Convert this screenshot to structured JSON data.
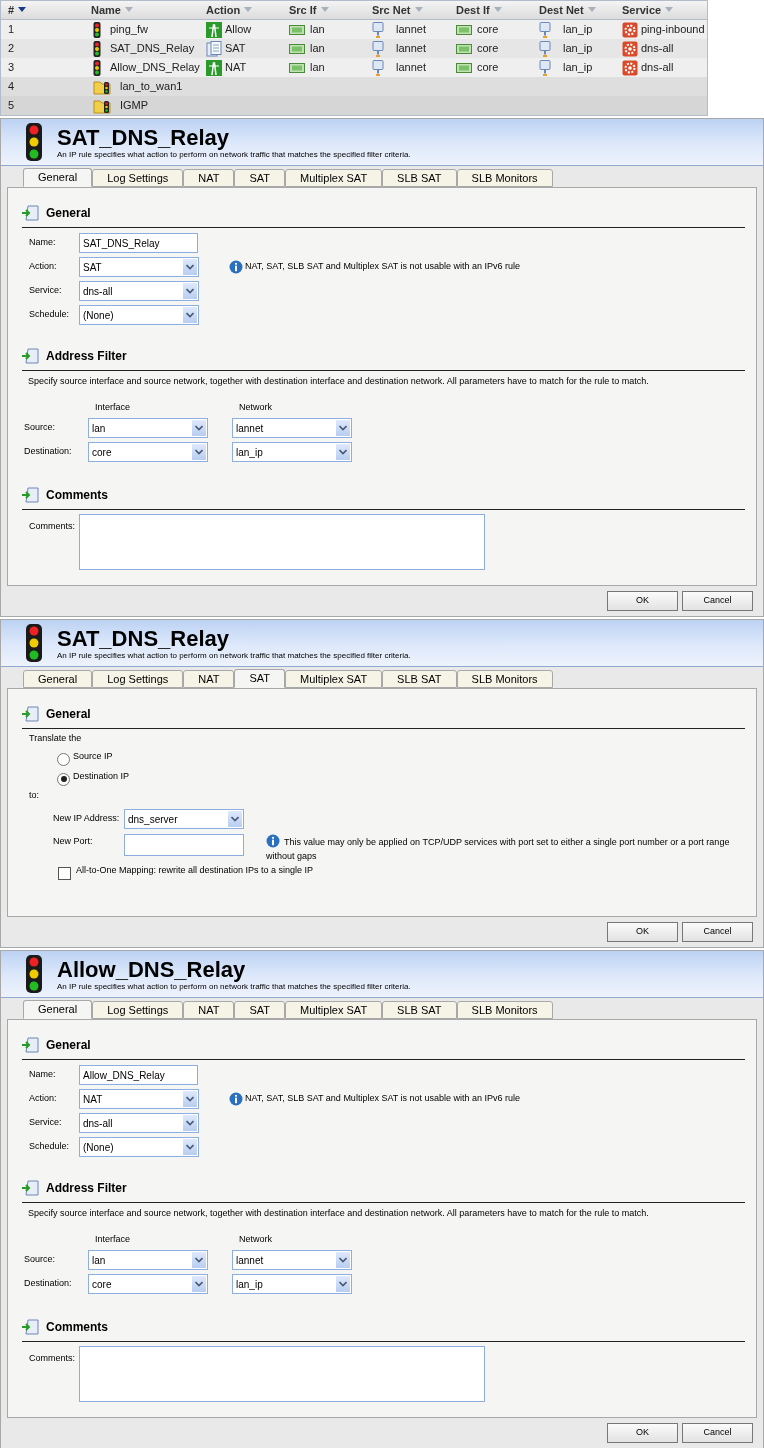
{
  "rules_table": {
    "columns": [
      {
        "label": "#",
        "sorted": true
      },
      {
        "label": "Name",
        "sorted": false
      },
      {
        "label": "Action",
        "sorted": false
      },
      {
        "label": "Src If",
        "sorted": false
      },
      {
        "label": "Src Net",
        "sorted": false
      },
      {
        "label": "Dest If",
        "sorted": false
      },
      {
        "label": "Dest Net",
        "sorted": false
      },
      {
        "label": "Service",
        "sorted": false
      }
    ],
    "rows": [
      {
        "number": "1",
        "kind": "rule",
        "name": "ping_fw",
        "action": {
          "label": "Allow",
          "kind": "allow"
        },
        "src_if": "lan",
        "src_net": "lannet",
        "dest_if": "core",
        "dest_net": "lan_ip",
        "service": "ping-inbound"
      },
      {
        "number": "2",
        "kind": "rule",
        "name": "SAT_DNS_Relay",
        "action": {
          "label": "SAT",
          "kind": "sat"
        },
        "src_if": "lan",
        "src_net": "lannet",
        "dest_if": "core",
        "dest_net": "lan_ip",
        "service": "dns-all"
      },
      {
        "number": "3",
        "kind": "rule",
        "name": "Allow_DNS_Relay",
        "action": {
          "label": "NAT",
          "kind": "nat"
        },
        "src_if": "lan",
        "src_net": "lannet",
        "dest_if": "core",
        "dest_net": "lan_ip",
        "service": "dns-all"
      },
      {
        "number": "4",
        "kind": "folder",
        "name": "lan_to_wan1"
      },
      {
        "number": "5",
        "kind": "folder",
        "name": "IGMP"
      }
    ]
  },
  "panels": [
    {
      "kind": "general",
      "title": "SAT_DNS_Relay",
      "description": "An IP rule specifies what action to perform on network traffic that matches the specified filter criteria.",
      "tabs": [
        {
          "label": "General",
          "selected": true
        },
        {
          "label": "Log Settings",
          "selected": false
        },
        {
          "label": "NAT",
          "selected": false
        },
        {
          "label": "SAT",
          "selected": false
        },
        {
          "label": "Multiplex SAT",
          "selected": false
        },
        {
          "label": "SLB SAT",
          "selected": false
        },
        {
          "label": "SLB Monitors",
          "selected": false
        }
      ],
      "general": {
        "heading": "General",
        "fields": [
          {
            "label": "Name:",
            "kind": "text",
            "value": "SAT_DNS_Relay"
          },
          {
            "label": "Action:",
            "kind": "select",
            "value": "SAT",
            "note": "NAT, SAT, SLB SAT and Multiplex SAT is not usable with an IPv6 rule"
          },
          {
            "label": "Service:",
            "kind": "select",
            "value": "dns-all"
          },
          {
            "label": "Schedule:",
            "kind": "select",
            "value": "(None)"
          }
        ]
      },
      "address_filter": {
        "heading": "Address Filter",
        "description": "Specify source interface and source network, together with destination interface and destination network. All parameters have to match for the rule to match.",
        "interface_header": "Interface",
        "network_header": "Network",
        "rows": [
          {
            "label": "Source:",
            "interface": "lan",
            "network": "lannet"
          },
          {
            "label": "Destination:",
            "interface": "core",
            "network": "lan_ip"
          }
        ]
      },
      "comments": {
        "heading": "Comments",
        "label": "Comments:"
      },
      "buttons": [
        "OK",
        "Cancel"
      ]
    },
    {
      "kind": "sat",
      "title": "SAT_DNS_Relay",
      "description": "An IP rule specifies what action to perform on network traffic that matches the specified filter criteria.",
      "tabs": [
        {
          "label": "General",
          "selected": false
        },
        {
          "label": "Log Settings",
          "selected": false
        },
        {
          "label": "NAT",
          "selected": false
        },
        {
          "label": "SAT",
          "selected": true
        },
        {
          "label": "Multiplex SAT",
          "selected": false
        },
        {
          "label": "SLB SAT",
          "selected": false
        },
        {
          "label": "SLB Monitors",
          "selected": false
        }
      ],
      "sat": {
        "heading": "General",
        "translate_label": "Translate the",
        "options": [
          {
            "label": "Source IP",
            "selected": false
          },
          {
            "label": "Destination IP",
            "selected": true
          }
        ],
        "to_label": "to:",
        "new_ip": {
          "label": "New IP Address:",
          "value": "dns_server"
        },
        "new_port": {
          "label": "New Port:",
          "note": "This value may only be applied on TCP/UDP services with port set to either a single port number or a port range without gaps"
        },
        "all_to_one": {
          "label": "All-to-One Mapping: rewrite all destination IPs to a single IP",
          "checked": false
        }
      },
      "buttons": [
        "OK",
        "Cancel"
      ]
    },
    {
      "kind": "general",
      "title": "Allow_DNS_Relay",
      "description": "An IP rule specifies what action to perform on network traffic that matches the specified filter criteria.",
      "tabs": [
        {
          "label": "General",
          "selected": true
        },
        {
          "label": "Log Settings",
          "selected": false
        },
        {
          "label": "NAT",
          "selected": false
        },
        {
          "label": "SAT",
          "selected": false
        },
        {
          "label": "Multiplex SAT",
          "selected": false
        },
        {
          "label": "SLB SAT",
          "selected": false
        },
        {
          "label": "SLB Monitors",
          "selected": false
        }
      ],
      "general": {
        "heading": "General",
        "fields": [
          {
            "label": "Name:",
            "kind": "text",
            "value": "Allow_DNS_Relay"
          },
          {
            "label": "Action:",
            "kind": "select",
            "value": "NAT",
            "note": "NAT, SAT, SLB SAT and Multiplex SAT is not usable with an IPv6 rule"
          },
          {
            "label": "Service:",
            "kind": "select",
            "value": "dns-all"
          },
          {
            "label": "Schedule:",
            "kind": "select",
            "value": "(None)"
          }
        ]
      },
      "address_filter": {
        "heading": "Address Filter",
        "description": "Specify source interface and source network, together with destination interface and destination network. All parameters have to match for the rule to match.",
        "interface_header": "Interface",
        "network_header": "Network",
        "rows": [
          {
            "label": "Source:",
            "interface": "lan",
            "network": "lannet"
          },
          {
            "label": "Destination:",
            "interface": "core",
            "network": "lan_ip"
          }
        ]
      },
      "comments": {
        "heading": "Comments",
        "label": "Comments:"
      },
      "buttons": [
        "OK",
        "Cancel"
      ]
    }
  ]
}
